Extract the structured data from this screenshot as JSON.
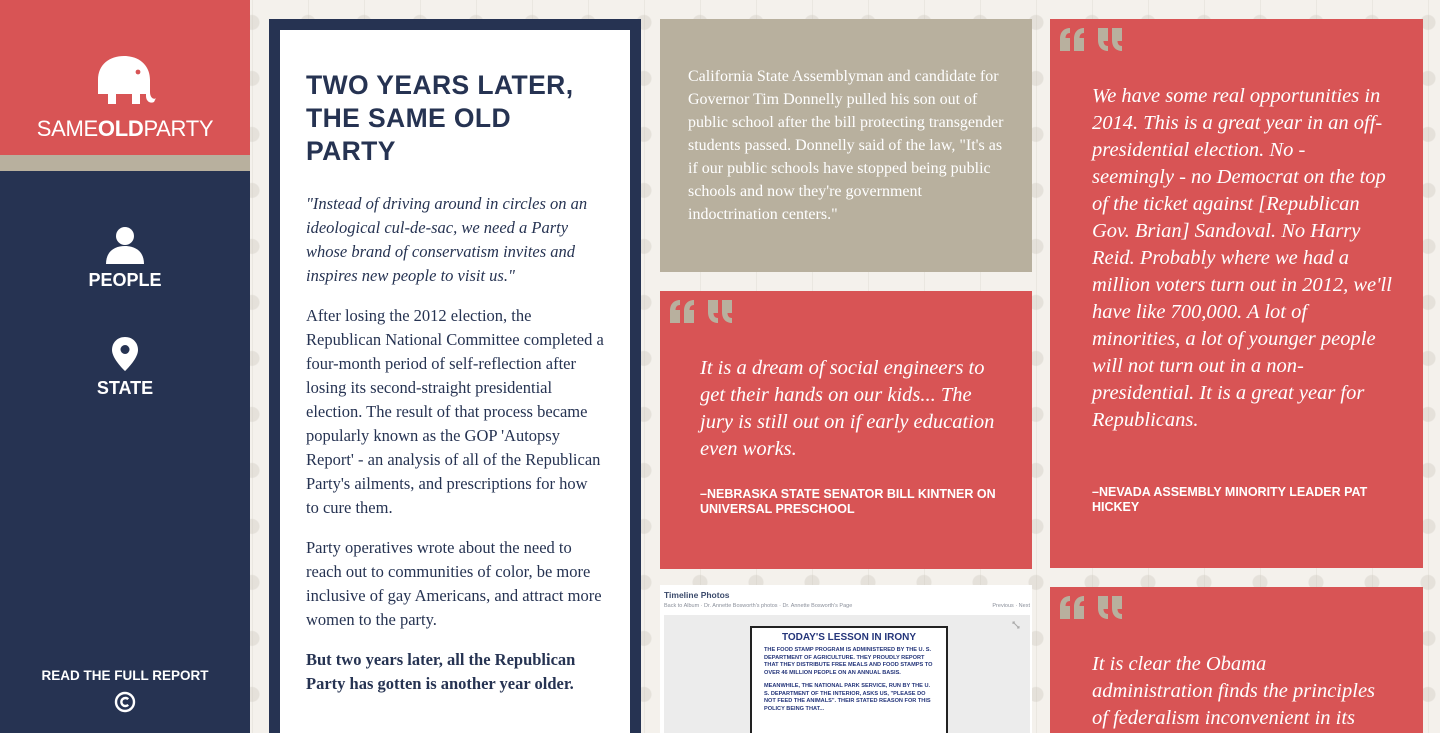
{
  "brand": {
    "word1": "SAME",
    "word2": "OLD",
    "word3": "PARTY",
    "logo_icon": "elephant-icon",
    "colors": {
      "red": "#d85455",
      "navy": "#263352",
      "tan": "#b8b09e"
    }
  },
  "nav": {
    "items": [
      {
        "label": "PEOPLE",
        "icon": "person-icon"
      },
      {
        "label": "STATE",
        "icon": "map-pin-icon"
      }
    ],
    "report_link": "READ THE FULL REPORT",
    "copyright_icon": "copyright-icon"
  },
  "intro": {
    "title": "TWO YEARS LATER, THE SAME OLD PARTY",
    "quote": "\"Instead of driving around in circles on an ideological cul-de-sac, we need a Party whose brand of conservatism invites and inspires new people to visit us.\"",
    "paragraphs": [
      "After losing the 2012 election, the Republican National Committee completed a four-month period of self-reflection after losing its second-straight presidential election. The result of that process became popularly known as the GOP 'Autopsy Report' - an analysis of all of the Republican Party's ailments, and prescriptions for how to cure them.",
      "Party operatives wrote about the need to reach out to communities of color, be more inclusive of gay Americans, and attract more women to the party."
    ],
    "closing": "But two years later, all the Republican Party has gotten is another year older."
  },
  "fact": {
    "text": "California State Assemblyman and candidate for Governor Tim Donnelly pulled his son out of public school after the bill protecting transgender students passed. Donnelly said of the law, \"It's as if our public schools have stopped being public schools and now they're government indoctrination centers.\""
  },
  "quotes": [
    {
      "text": "It is a dream of social engineers to get their hands on our kids... The jury is still out on if early education even works.",
      "attribution": "–NEBRASKA STATE SENATOR BILL KINTNER ON UNIVERSAL PRESCHOOL"
    },
    {
      "text": "We have some real opportunities in 2014. This is a great year in an off-presidential election. No - seemingly - no Democrat on the top of the ticket against [Republican Gov. Brian] Sandoval. No Harry Reid. Probably where we had a million voters turn out in 2012, we'll have like 700,000. A lot of minorities, a lot of younger people will not turn out in a non-presidential. It is a great year for Republicans.",
      "attribution": "–NEVADA ASSEMBLY MINORITY LEADER PAT HICKEY"
    },
    {
      "text": "It is clear the Obama administration finds the principles of federalism inconvenient in its",
      "attribution": ""
    }
  ],
  "photo": {
    "title": "Timeline Photos",
    "breadcrumb": "Back to Album · Dr. Annette Bosworth's photos · Dr. Annette Bosworth's Page",
    "nav": "Previous · Next",
    "lesson_title": "TODAY'S LESSON IN IRONY",
    "lesson_p1": "THE FOOD STAMP PROGRAM IS ADMINISTERED BY THE U. S. DEPARTMENT OF AGRICULTURE. THEY PROUDLY REPORT THAT THEY DISTRIBUTE FREE MEALS AND FOOD STAMPS TO OVER 46 MILLION PEOPLE ON AN ANNUAL BASIS.",
    "lesson_p2": "MEANWHILE, THE NATIONAL PARK SERVICE, RUN BY THE U. S. DEPARTMENT OF THE INTERIOR, ASKS US, \"PLEASE DO NOT FEED THE ANIMALS\". THEIR STATED REASON FOR THIS POLICY BEING THAT..."
  }
}
